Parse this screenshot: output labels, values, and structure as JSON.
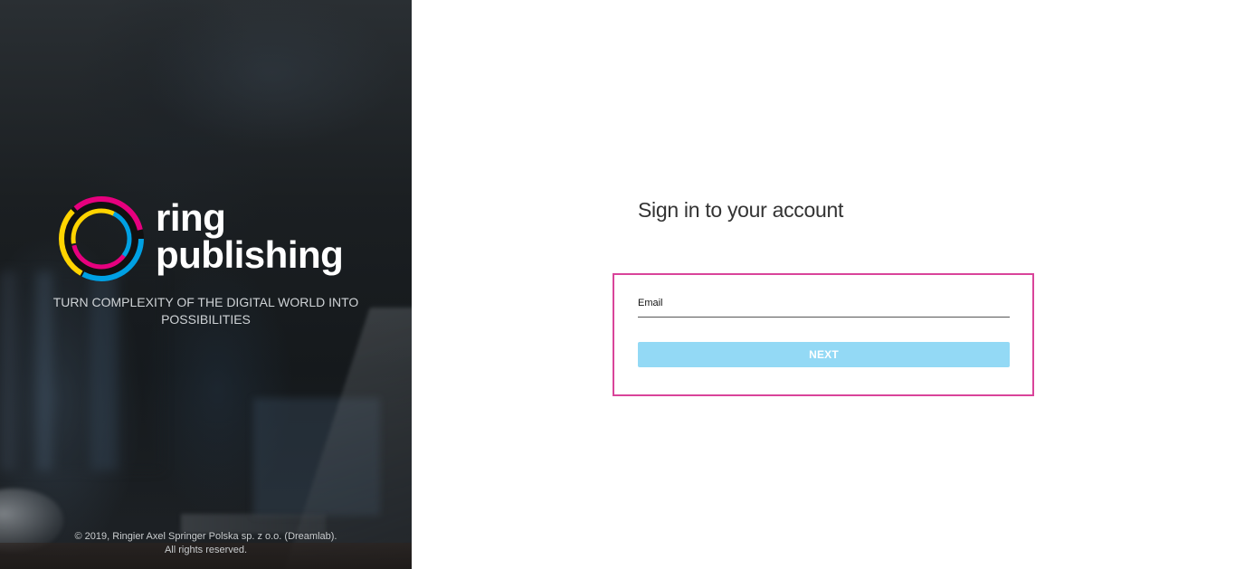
{
  "branding": {
    "wordmark_line1": "ring",
    "wordmark_line2": "publishing",
    "logo_icon": "ring-logo-icon",
    "logo_colors": [
      "#00a0e3",
      "#ffd400",
      "#e6007e",
      "#111111"
    ],
    "tagline_line1": "TURN COMPLEXITY OF THE DIGITAL WORLD INTO",
    "tagline_line2": "POSSIBILITIES"
  },
  "footer": {
    "copyright_line1": "© 2019, Ringier Axel Springer Polska sp. z o.o. (Dreamlab).",
    "copyright_line2": "All rights reserved."
  },
  "signin": {
    "title": "Sign in to your account",
    "email_placeholder": "Email",
    "email_value": "",
    "next_label": "NEXT"
  },
  "colors": {
    "focus_border": "#d9449a",
    "button_bg": "#93d9f5",
    "title_text": "#333333"
  }
}
